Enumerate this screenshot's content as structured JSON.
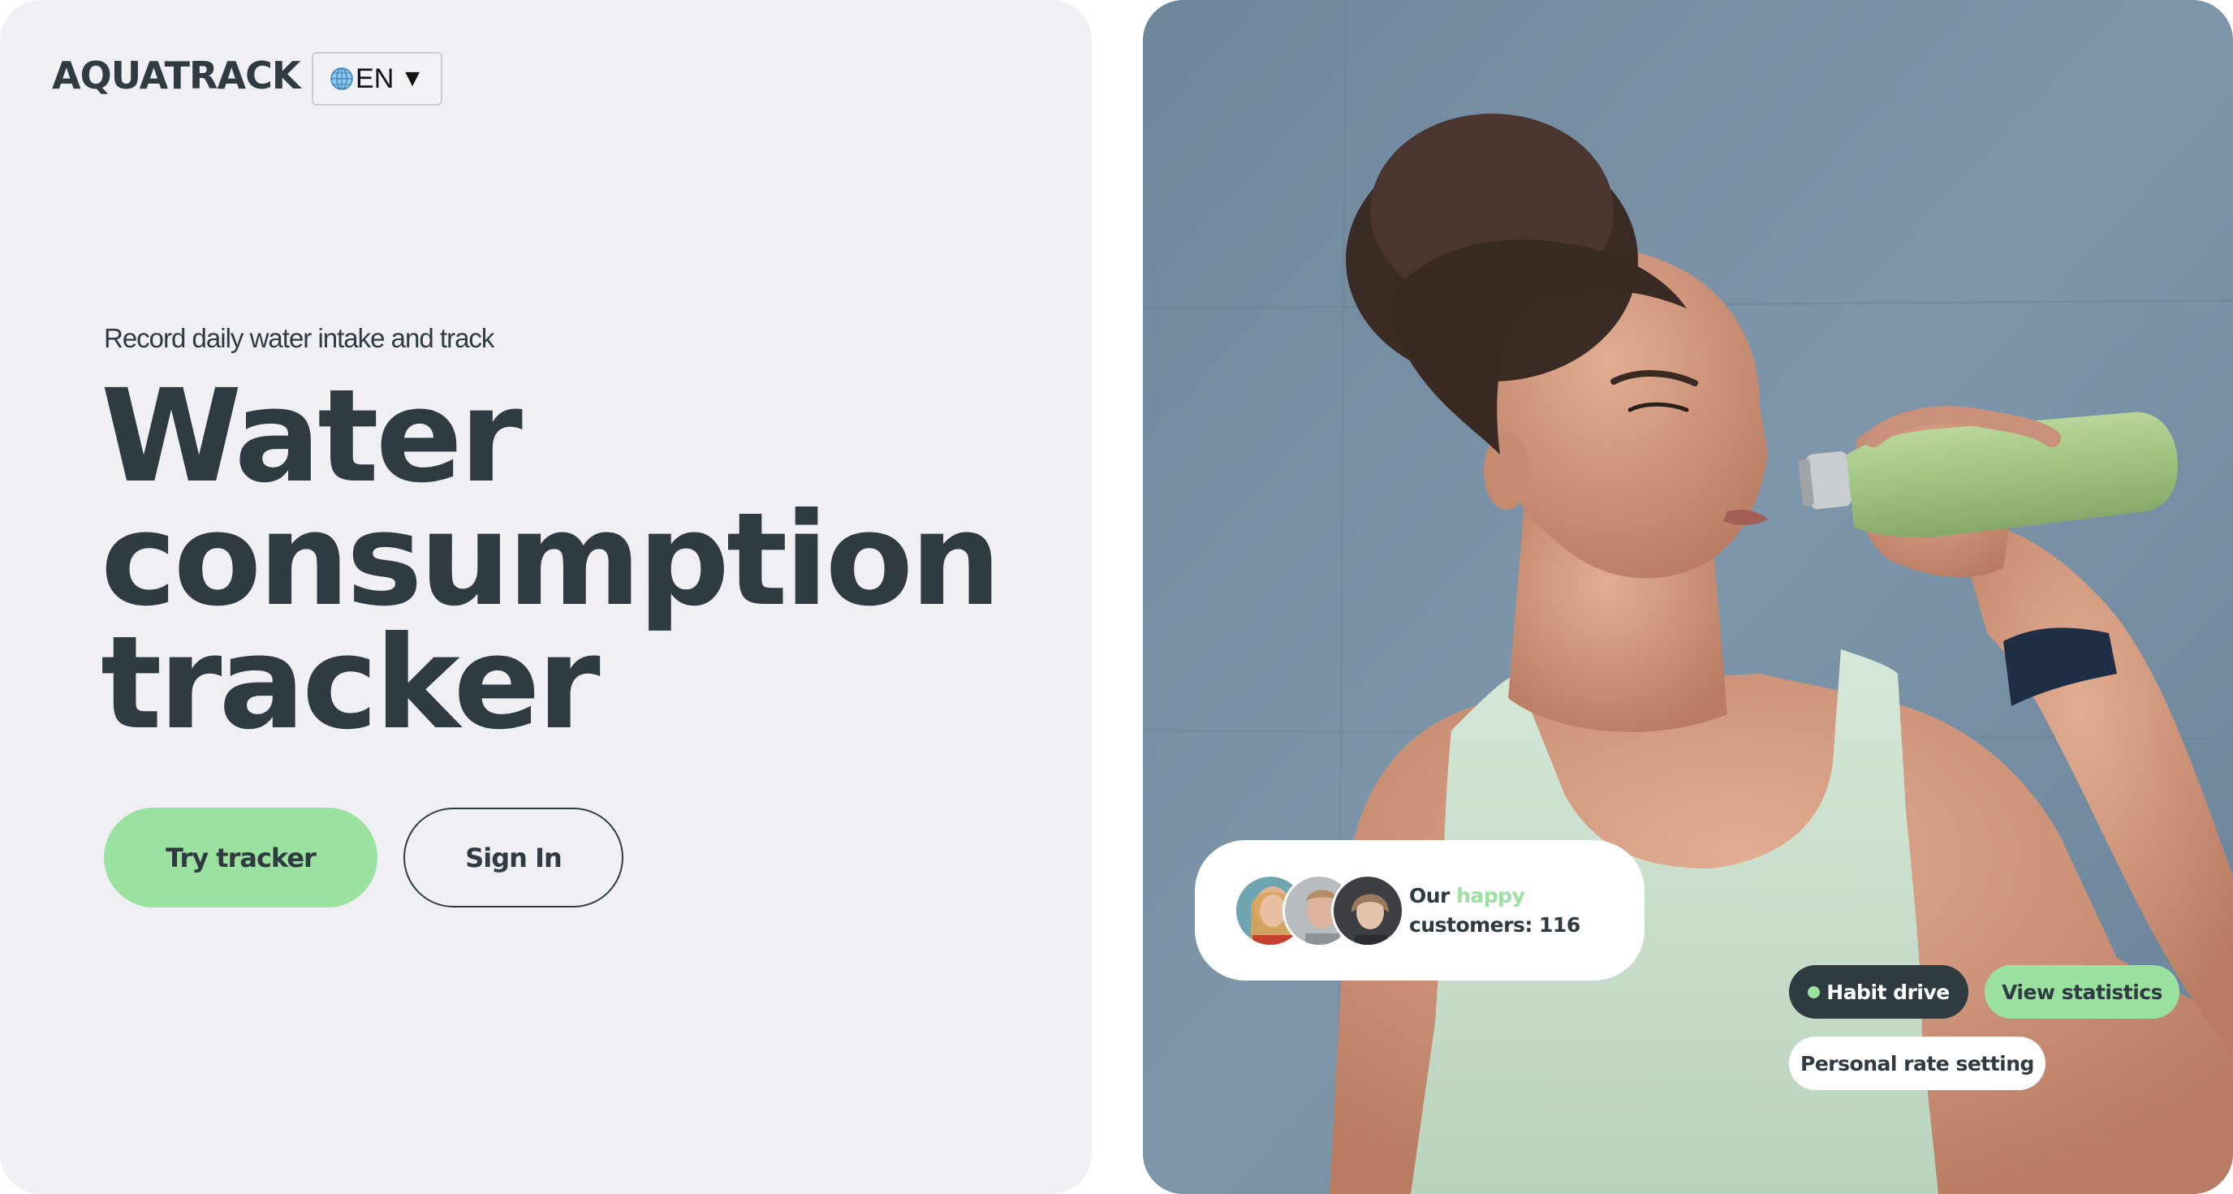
{
  "header": {
    "logo": "AQUATRACK",
    "language": {
      "icon": "globe-icon",
      "selected": "EN",
      "caret": "▼"
    }
  },
  "hero": {
    "subtitle": "Record daily water intake and track",
    "headline_lines": [
      "Water",
      "consumption",
      "tracker"
    ],
    "try_button": "Try tracker",
    "signin_button": "Sign In"
  },
  "photo_overlay": {
    "customers": {
      "prefix": "Our",
      "highlight": "happy",
      "line2": "customers: 116"
    },
    "chips": {
      "habit": "Habit drive",
      "statistics": "View statistics",
      "rate": "Personal rate setting"
    }
  },
  "colors": {
    "accent_green": "#9be1a0",
    "dark_text": "#2f3a41",
    "left_background": "#efeff4",
    "photo_wall": "#7890a4"
  }
}
